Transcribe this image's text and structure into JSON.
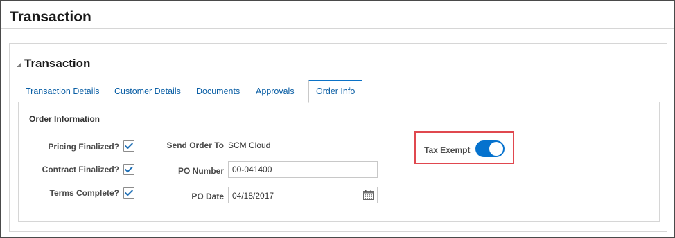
{
  "page": {
    "title": "Transaction"
  },
  "section": {
    "title": "Transaction"
  },
  "tabs": [
    {
      "label": "Transaction Details"
    },
    {
      "label": "Customer Details"
    },
    {
      "label": "Documents"
    },
    {
      "label": "Approvals"
    },
    {
      "label": "Order Info",
      "selected": true
    }
  ],
  "order_info": {
    "title": "Order Information",
    "pricing_finalized": {
      "label": "Pricing Finalized?",
      "checked": true
    },
    "contract_finalized": {
      "label": "Contract Finalized?",
      "checked": true
    },
    "terms_complete": {
      "label": "Terms Complete?",
      "checked": true
    },
    "send_order_to": {
      "label": "Send Order To",
      "value": "SCM Cloud"
    },
    "po_number": {
      "label": "PO Number",
      "value": "00-041400"
    },
    "po_date": {
      "label": "PO Date",
      "value": "04/18/2017"
    },
    "tax_exempt": {
      "label": "Tax Exempt",
      "on": true
    }
  },
  "colors": {
    "link": "#0b5fa5",
    "accent": "#0572ce",
    "highlight_border": "#e0484f"
  },
  "icons": [
    "collapse-triangle-icon",
    "checkbox-check-icon",
    "calendar-icon"
  ]
}
